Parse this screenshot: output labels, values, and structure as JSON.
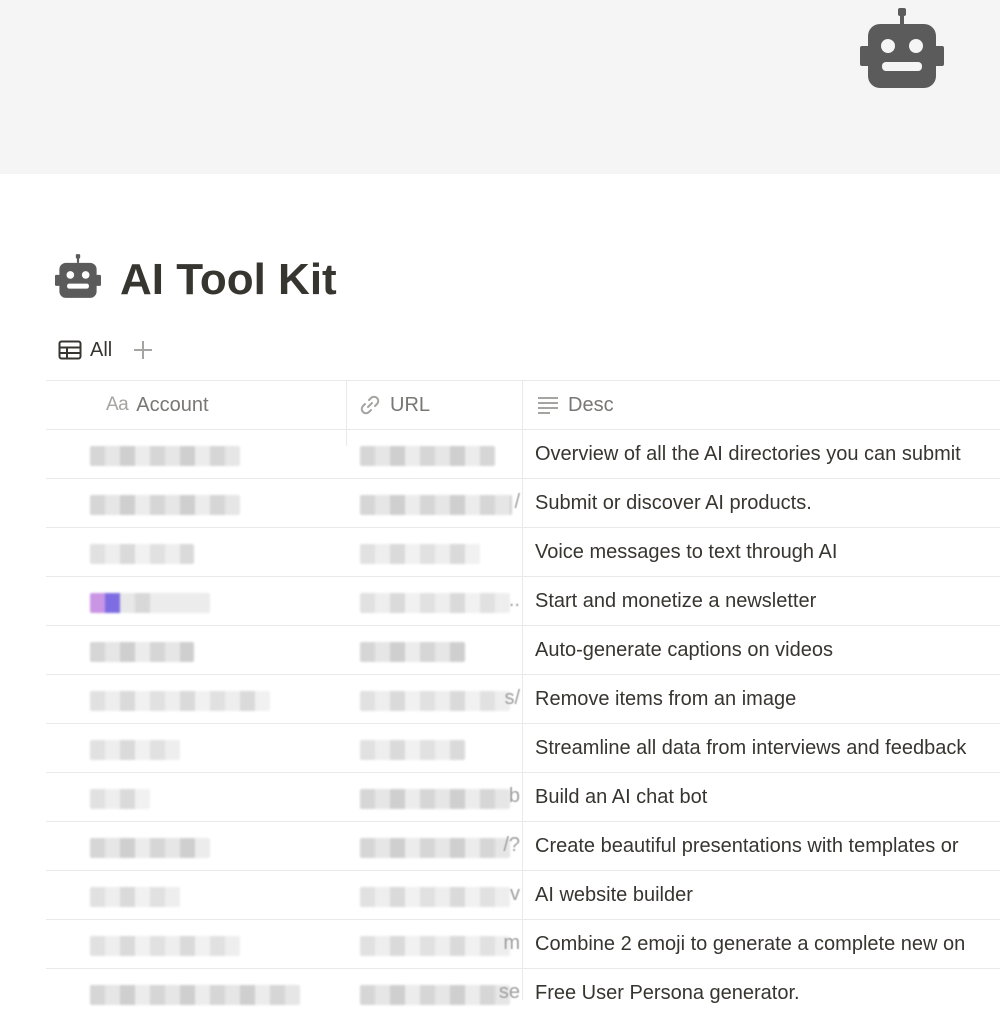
{
  "cover": {
    "icon": "robot-icon"
  },
  "page": {
    "title": "AI Tool Kit",
    "icon": "robot-icon"
  },
  "views": {
    "tabs": [
      {
        "label": "All",
        "icon": "table-icon"
      }
    ],
    "add_icon": "plus-icon"
  },
  "table": {
    "columns": [
      {
        "label": "Account",
        "type_glyph": "Aa"
      },
      {
        "label": "URL",
        "icon": "link-icon"
      },
      {
        "label": "Desc",
        "icon": "text-lines-icon"
      }
    ],
    "rows": [
      {
        "desc": "Overview of all the AI directories you can submit"
      },
      {
        "desc": "Submit or discover AI products."
      },
      {
        "desc": "Voice messages to text through AI"
      },
      {
        "desc": "Start and monetize a newsletter"
      },
      {
        "desc": "Auto-generate captions on videos"
      },
      {
        "desc": "Remove items from an image"
      },
      {
        "desc": "Streamline all data from interviews and feedback"
      },
      {
        "desc": "Build an AI chat bot"
      },
      {
        "desc": "Create beautiful presentations with templates or"
      },
      {
        "desc": "AI website builder"
      },
      {
        "desc": "Combine 2 emoji to generate a complete new on"
      },
      {
        "desc": "Free User Persona generator."
      }
    ]
  },
  "colors": {
    "text": "#37352f",
    "muted": "#787774",
    "border": "#e9e9e7",
    "cover": "#f6f5f5",
    "icon": "#5b5b5b"
  }
}
